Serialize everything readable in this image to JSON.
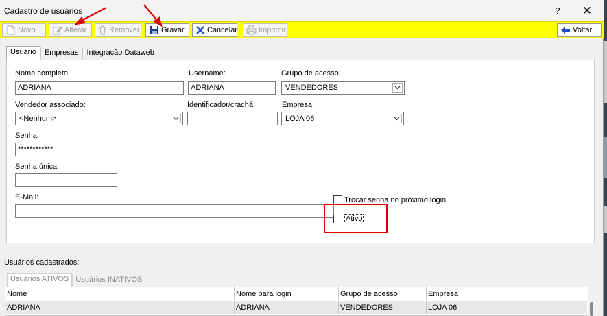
{
  "window": {
    "title": "Cadastro de usuários",
    "help_label": "?",
    "close_label": "✕"
  },
  "toolbar": {
    "novo": "Novo",
    "alterar": "Alterar",
    "remover": "Remover",
    "gravar": "Gravar",
    "cancelar": "Cancelar",
    "imprimir": "Imprimir",
    "voltar": "Voltar"
  },
  "tabs": [
    "Usuário",
    "Empresas",
    "Integração Dataweb"
  ],
  "form": {
    "nome_label": "Nome completo:",
    "nome_value": "ADRIANA",
    "username_label": "Username:",
    "username_value": "ADRIANA",
    "grupo_label": "Grupo de acesso:",
    "grupo_value": "VENDEDORES",
    "vendedor_label": "Vendedor associado:",
    "vendedor_value": "<Nenhum>",
    "ident_label": "Identificador/crachá:",
    "ident_value": "",
    "empresa_label": "Empresa:",
    "empresa_value": "LOJA 06",
    "senha_label": "Senha:",
    "senha_value": "************",
    "senha_unica_label": "Senha única:",
    "senha_unica_value": "",
    "email_label": "E-Mail:",
    "email_value": "",
    "trocar_senha_label": "Trocar senha no próximo login",
    "ativo_label": "Ativo"
  },
  "users": {
    "group_label": "Usuários cadastrados:",
    "tabs": [
      "Usuários ATIVOS",
      "Usuários INATIVOS"
    ],
    "columns": [
      "Nome",
      "Nome para login",
      "Grupo de acesso",
      "Empresa"
    ],
    "rows": [
      [
        "ADRIANA",
        "ADRIANA",
        "VENDEDORES",
        "LOJA 06"
      ]
    ]
  },
  "colors": {
    "toolbar_bg": "#ffff00",
    "annotation": "#e00000"
  }
}
